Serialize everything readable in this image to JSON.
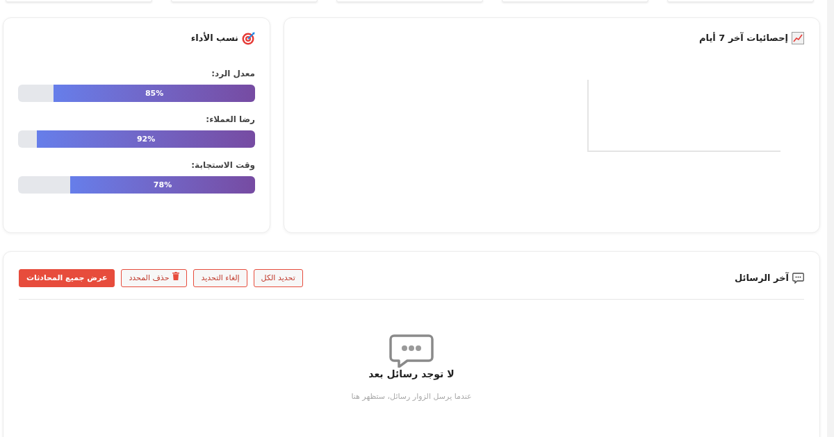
{
  "stats": {
    "title": "إحصائيات آخر 7 أيام"
  },
  "performance": {
    "title": "نسب الأداء",
    "metrics": [
      {
        "label": "معدل الرد:",
        "level": 0.85,
        "reading": "85%"
      },
      {
        "label": "رضا العملاء:",
        "level": 0.92,
        "reading": "92%"
      },
      {
        "label": "وقت الاستجابة:",
        "level": 0.78,
        "reading": "78%"
      }
    ]
  },
  "messages": {
    "title": "آخر الرسائل",
    "buttons": [
      {
        "label": "تحديد الكل",
        "kind": "outline"
      },
      {
        "label": "إلغاء التحديد",
        "kind": "outline"
      },
      {
        "label": "حذف المحدد",
        "kind": "delete"
      },
      {
        "label": "عرض جميع المحادثات",
        "kind": "primary"
      }
    ],
    "empty_state": {
      "title": "لا توجد رسائل بعد",
      "subtitle": "عندما يرسل الزوار رسائل، ستظهر هنا"
    }
  }
}
